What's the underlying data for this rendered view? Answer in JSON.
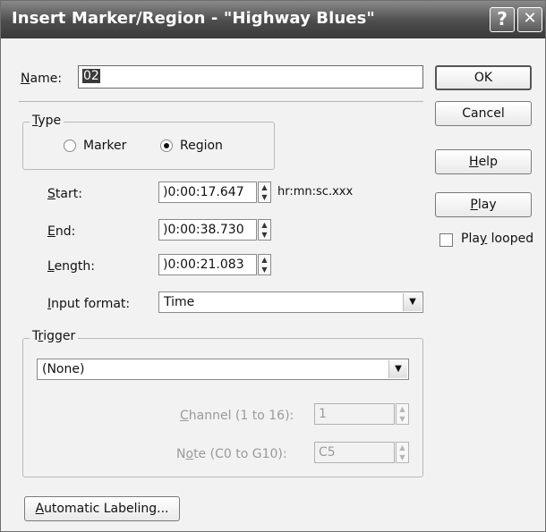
{
  "window": {
    "title": "Insert Marker/Region - \"Highway Blues\"",
    "help_glyph": "?",
    "close_glyph": "✕"
  },
  "name_field": {
    "label": "Name:",
    "value": "02"
  },
  "buttons": {
    "ok": "OK",
    "cancel": "Cancel",
    "help": "Help",
    "play": "Play",
    "auto_label": "Automatic Labeling..."
  },
  "play_looped": {
    "label": "Play looped",
    "checked": false
  },
  "type_group": {
    "label": "Type",
    "options": [
      "Marker",
      "Region"
    ],
    "selected": "Region"
  },
  "times": {
    "start": {
      "label": "Start:",
      "value": ")0:00:17.647"
    },
    "end": {
      "label": "End:",
      "value": ")0:00:38.730"
    },
    "length": {
      "label": "Length:",
      "value": ")0:00:21.083"
    },
    "unit_hint": "hr:mn:sc.xxx"
  },
  "input_format": {
    "label": "Input format:",
    "value": "Time"
  },
  "trigger": {
    "label": "Trigger",
    "value": "(None)",
    "channel": {
      "label": "Channel (1 to 16):",
      "value": "1"
    },
    "note": {
      "label": "Note (C0 to G10):",
      "value": "C5"
    }
  }
}
